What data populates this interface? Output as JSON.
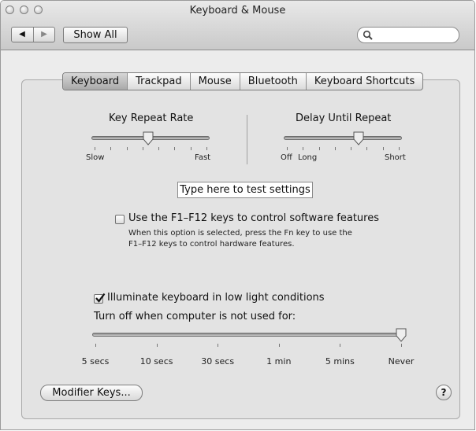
{
  "window": {
    "title": "Keyboard & Mouse"
  },
  "toolbar": {
    "back_label": "◀",
    "forward_label": "▶",
    "show_all_label": "Show All",
    "search_value": ""
  },
  "tabs": [
    {
      "label": "Keyboard",
      "active": true
    },
    {
      "label": "Trackpad",
      "active": false
    },
    {
      "label": "Mouse",
      "active": false
    },
    {
      "label": "Bluetooth",
      "active": false
    },
    {
      "label": "Keyboard Shortcuts",
      "active": false
    }
  ],
  "key_repeat": {
    "label": "Key Repeat Rate",
    "min_label": "Slow",
    "max_label": "Fast",
    "value_fraction": 0.48
  },
  "delay_repeat": {
    "label": "Delay Until Repeat",
    "off_label": "Off",
    "min_label": "Long",
    "max_label": "Short",
    "value_fraction": 0.64
  },
  "test_field": {
    "value": "Type here to test settings"
  },
  "fkeys": {
    "checked": false,
    "label": "Use the F1–F12 keys to control software features",
    "help_line1": "When this option is selected, press the Fn key to use the",
    "help_line2": "F1–F12 keys to control hardware features."
  },
  "illumination": {
    "checked": true,
    "label": "Illuminate keyboard in low light conditions",
    "turnoff_label": "Turn off when computer is not used for:",
    "ticks": [
      "5 secs",
      "10 secs",
      "30 secs",
      "1 min",
      "5 mins",
      "Never"
    ],
    "selected_index": 5
  },
  "bottom": {
    "modifier_label": "Modifier Keys...",
    "help_label": "?"
  }
}
